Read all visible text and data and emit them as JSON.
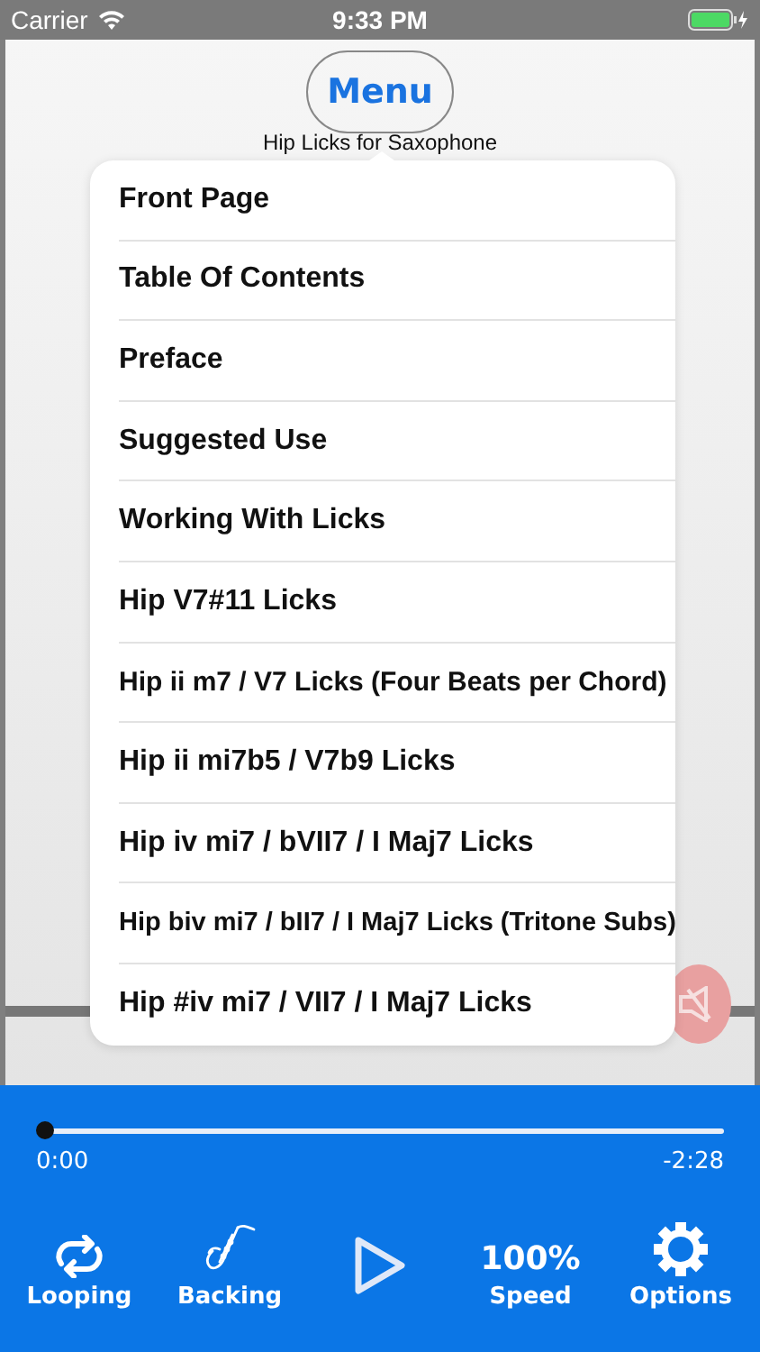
{
  "status_bar": {
    "carrier": "Carrier",
    "time": "9:33 PM"
  },
  "header": {
    "menu_button": "Menu",
    "subtitle": "Hip Licks for Saxophone"
  },
  "menu": {
    "items": [
      {
        "label": "Front Page"
      },
      {
        "label": "Table Of Contents"
      },
      {
        "label": "Preface"
      },
      {
        "label": "Suggested Use"
      },
      {
        "label": "Working With Licks"
      },
      {
        "label": "Hip V7#11 Licks"
      },
      {
        "label": "Hip ii m7 / V7 Licks (Four Beats per Chord)"
      },
      {
        "label": "Hip ii mi7b5 / V7b9 Licks"
      },
      {
        "label": "Hip iv mi7 / bVII7 / I Maj7 Licks"
      },
      {
        "label": "Hip biv mi7 / bII7 / I Maj7 Licks (Tritone Subs)"
      },
      {
        "label": "Hip #iv mi7 / VII7 / I Maj7 Licks"
      }
    ]
  },
  "player": {
    "level": 0,
    "elapsed": "0:00",
    "remaining": "-2:28"
  },
  "controls": [
    {
      "kind": "looping",
      "label": "Looping"
    },
    {
      "kind": "backing",
      "label": "Backing"
    },
    {
      "kind": "play"
    },
    {
      "kind": "speed",
      "value": "100%",
      "label": "Speed"
    },
    {
      "kind": "options",
      "label": "Options"
    }
  ]
}
